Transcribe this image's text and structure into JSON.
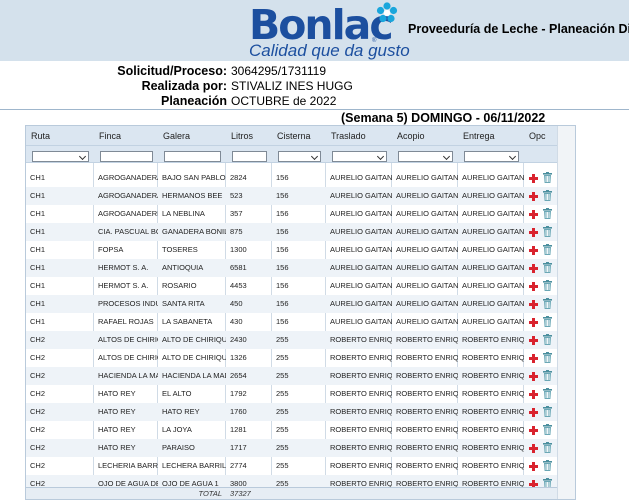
{
  "logo": {
    "brand": "Bonlac",
    "tagline": "Calidad que da gusto",
    "reg": "®"
  },
  "header": {
    "title": "Proveeduría de Leche - Planeación Diaria"
  },
  "info": {
    "solicitud_label": "Solicitud/Proceso:",
    "solicitud_value": "3064295/1731119",
    "realizada_label": "Realizada por:",
    "realizada_value": "STIVALIZ INES HUGG",
    "planeacion_label": "Planeación",
    "planeacion_value": "OCTUBRE de 2022"
  },
  "week_banner": "(Semana 5) DOMINGO - 06/11/2022",
  "grid": {
    "columns": [
      "Ruta",
      "Finca",
      "Galera",
      "Litros",
      "Cisterna",
      "Traslado",
      "Acopio",
      "Entrega",
      "Opc"
    ],
    "filters": [
      "select",
      "input",
      "input",
      "input",
      "select",
      "select",
      "select",
      "select",
      "none"
    ],
    "rows": [
      [
        "CH1",
        "AGROGANADERA B",
        "BAJO SAN PABLO",
        "2824",
        "156",
        "AURELIO GAITAN",
        "AURELIO GAITAN",
        "AURELIO GAITAN"
      ],
      [
        "CH1",
        "AGROGANADERA H",
        "HERMANOS BEE",
        "523",
        "156",
        "AURELIO GAITAN",
        "AURELIO GAITAN",
        "AURELIO GAITAN"
      ],
      [
        "CH1",
        "AGROGANADERIA L",
        "LA NEBLINA",
        "357",
        "156",
        "AURELIO GAITAN",
        "AURELIO GAITAN",
        "AURELIO GAITAN"
      ],
      [
        "CH1",
        "CIA. PASCUAL BON",
        "GANADERA BONILL",
        "875",
        "156",
        "AURELIO GAITAN",
        "AURELIO GAITAN",
        "AURELIO GAITAN"
      ],
      [
        "CH1",
        "FOPSA",
        "TOSERES",
        "1300",
        "156",
        "AURELIO GAITAN",
        "AURELIO GAITAN",
        "AURELIO GAITAN"
      ],
      [
        "CH1",
        "HERMOT S. A.",
        "ANTIOQUIA",
        "6581",
        "156",
        "AURELIO GAITAN",
        "AURELIO GAITAN",
        "AURELIO GAITAN"
      ],
      [
        "CH1",
        "HERMOT S. A.",
        "ROSARIO",
        "4453",
        "156",
        "AURELIO GAITAN",
        "AURELIO GAITAN",
        "AURELIO GAITAN"
      ],
      [
        "CH1",
        "PROCESOS INDUST",
        "SANTA RITA",
        "450",
        "156",
        "AURELIO GAITAN",
        "AURELIO GAITAN",
        "AURELIO GAITAN"
      ],
      [
        "CH1",
        "RAFAEL ROJAS",
        "LA SABANETA",
        "430",
        "156",
        "AURELIO GAITAN",
        "AURELIO GAITAN",
        "AURELIO GAITAN"
      ],
      [
        "CH2",
        "ALTOS DE CHIRIQU",
        "ALTO DE CHIRIQUI",
        "2430",
        "255",
        "ROBERTO ENRIQUE",
        "ROBERTO ENRIQUE",
        "ROBERTO ENRIQUE"
      ],
      [
        "CH2",
        "ALTOS DE CHIRIQU",
        "ALTO DE CHIRIQUI",
        "1326",
        "255",
        "ROBERTO ENRIQUE",
        "ROBERTO ENRIQUE",
        "ROBERTO ENRIQUE"
      ],
      [
        "CH2",
        "HACIENDA LA MAD",
        "HACIENDA LA MAD",
        "2654",
        "255",
        "ROBERTO ENRIQUE",
        "ROBERTO ENRIQUE",
        "ROBERTO ENRIQUE"
      ],
      [
        "CH2",
        "HATO REY",
        "EL ALTO",
        "1792",
        "255",
        "ROBERTO ENRIQUE",
        "ROBERTO ENRIQUE",
        "ROBERTO ENRIQUE"
      ],
      [
        "CH2",
        "HATO REY",
        "HATO REY",
        "1760",
        "255",
        "ROBERTO ENRIQUE",
        "ROBERTO ENRIQUE",
        "ROBERTO ENRIQUE"
      ],
      [
        "CH2",
        "HATO REY",
        "LA JOYA",
        "1281",
        "255",
        "ROBERTO ENRIQUE",
        "ROBERTO ENRIQUE",
        "ROBERTO ENRIQUE"
      ],
      [
        "CH2",
        "HATO REY",
        "PARAISO",
        "1717",
        "255",
        "ROBERTO ENRIQUE",
        "ROBERTO ENRIQUE",
        "ROBERTO ENRIQUE"
      ],
      [
        "CH2",
        "LECHERIA BARRILE",
        "LECHERA BARRILES",
        "2774",
        "255",
        "ROBERTO ENRIQUE",
        "ROBERTO ENRIQUE",
        "ROBERTO ENRIQUE"
      ],
      [
        "CH2",
        "OJO DE AGUA DE V",
        "OJO DE AGUA 1",
        "3800",
        "255",
        "ROBERTO ENRIQUE",
        "ROBERTO ENRIQUE",
        "ROBERTO ENRIQUE"
      ]
    ],
    "row_actions": {
      "add_icon": "plus-icon",
      "delete_icon": "trash-icon"
    },
    "total_label": "TOTAL",
    "total_value": "37327"
  },
  "colors": {
    "brand_blue": "#1c4f9f",
    "add_red": "#d9232e",
    "trash_teal": "#4b8f9e",
    "header_bg": "#d4e1ec",
    "grid_header_bg": "#dbe6f1"
  }
}
